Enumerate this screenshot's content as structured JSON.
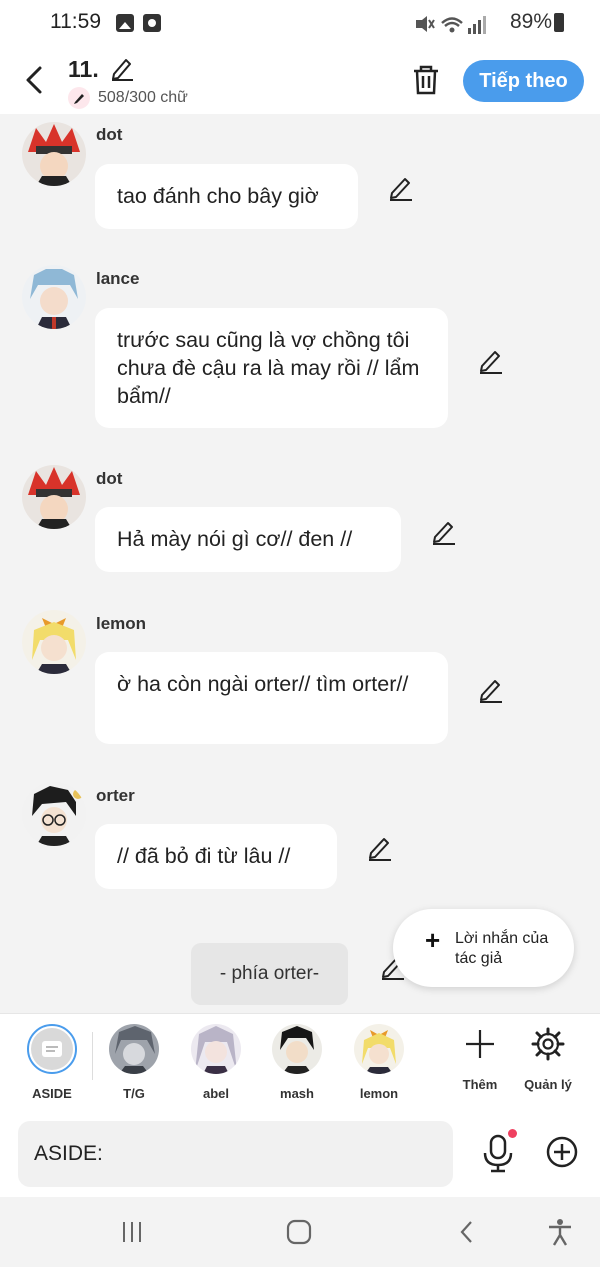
{
  "status_bar": {
    "time": "11:59",
    "battery": "89%"
  },
  "header": {
    "title": "11.",
    "word_count": "508/300 chữ",
    "next_label": "Tiếp theo"
  },
  "messages": [
    {
      "author": "dot",
      "text": "tao đánh cho bây giờ"
    },
    {
      "author": "lance",
      "text": "trước sau cũng là vợ chồng tôi chưa đè cậu ra là may rồi // lẩm bẩm//"
    },
    {
      "author": "dot",
      "text": "Hả mày nói gì cơ// đen //"
    },
    {
      "author": "lemon",
      "text": "ờ ha còn ngài orter// tìm orter//"
    },
    {
      "author": "orter",
      "text": "// đã bỏ đi từ lâu //"
    }
  ],
  "narration": "- phía orter-",
  "author_note": {
    "label": "Lời nhắn của tác giả"
  },
  "character_bar": {
    "items": [
      {
        "name": "ASIDE"
      },
      {
        "name": "T/G"
      },
      {
        "name": "abel"
      },
      {
        "name": "mash"
      },
      {
        "name": "lemon"
      }
    ],
    "add_label": "Thêm",
    "manage_label": "Quản lý"
  },
  "composer": {
    "placeholder": "ASIDE:"
  },
  "colors": {
    "accent": "#4a9cec",
    "background": "#f3f3f3",
    "notification_dot": "#ef4060"
  }
}
